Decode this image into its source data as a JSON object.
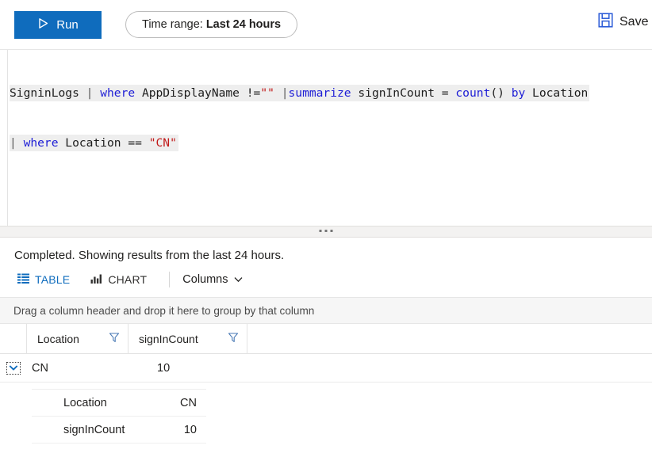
{
  "toolbar": {
    "run_label": "Run",
    "run_icon": "play-triangle-icon",
    "run_bg_color": "#0f6cbd",
    "timerange_label": "Time range:",
    "timerange_value": "Last 24 hours",
    "save_label": "Save",
    "save_icon": "floppy-disk-save-icon",
    "save_icon_color": "#2b5bd7"
  },
  "query": {
    "line1": [
      {
        "text": "SigninLogs ",
        "type": "plain"
      },
      {
        "text": "| ",
        "type": "pipe"
      },
      {
        "text": "where ",
        "type": "op"
      },
      {
        "text": "AppDisplayName !=",
        "type": "plain"
      },
      {
        "text": "\"\"",
        "type": "str"
      },
      {
        "text": " ",
        "type": "plain"
      },
      {
        "text": "|",
        "type": "pipe"
      },
      {
        "text": "summarize ",
        "type": "op"
      },
      {
        "text": "signInCount = ",
        "type": "plain"
      },
      {
        "text": "count",
        "type": "op"
      },
      {
        "text": "() ",
        "type": "plain"
      },
      {
        "text": "by ",
        "type": "op"
      },
      {
        "text": "Location",
        "type": "plain"
      }
    ],
    "line2": [
      {
        "text": "| ",
        "type": "pipe"
      },
      {
        "text": "where ",
        "type": "op"
      },
      {
        "text": "Location == ",
        "type": "plain"
      },
      {
        "text": "\"CN\"",
        "type": "str"
      }
    ],
    "plain_text": "SigninLogs | where AppDisplayName !=\"\" |summarize signInCount = count() by Location\n| where Location == \"CN\""
  },
  "splitter": {
    "handle_icon": "drag-handle-dots-icon"
  },
  "results": {
    "status": "Completed. Showing results from the last 24 hours.",
    "tabs": [
      {
        "label": "TABLE",
        "icon": "table-grid-icon",
        "active": true
      },
      {
        "label": "CHART",
        "icon": "bar-chart-icon",
        "active": false
      }
    ],
    "columns_menu_label": "Columns",
    "columns_menu_icon": "chevron-down-icon",
    "group_bar_text": "Drag a column header and drop it here to group by that column",
    "grid": {
      "headers": [
        {
          "label": "Location",
          "filter_icon": "funnel-filter-icon"
        },
        {
          "label": "signInCount",
          "filter_icon": "funnel-filter-icon"
        }
      ],
      "rows": [
        {
          "expander_icon": "chevron-down-icon",
          "expanded": true,
          "cells": [
            "CN",
            "10"
          ],
          "detail": [
            {
              "key": "Location",
              "value": "CN"
            },
            {
              "key": "signInCount",
              "value": "10"
            }
          ]
        }
      ]
    }
  },
  "colors": {
    "accent_blue": "#0f6cbd",
    "keyword_blue": "#1d1dd6",
    "string_red": "#c21a1a",
    "editor_line_bg": "#eeeeee"
  }
}
